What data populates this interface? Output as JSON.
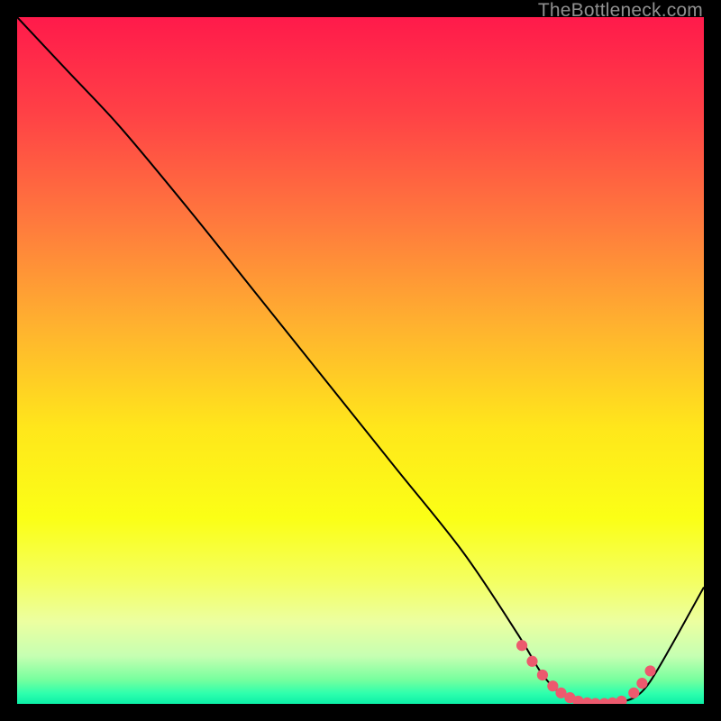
{
  "watermark": "TheBottleneck.com",
  "chart_data": {
    "type": "line",
    "title": "",
    "xlabel": "",
    "ylabel": "",
    "xlim": [
      0,
      100
    ],
    "ylim": [
      0,
      100
    ],
    "background": {
      "type": "vertical-gradient",
      "stops": [
        {
          "pos": 0.0,
          "color": "#ff1a4b"
        },
        {
          "pos": 0.14,
          "color": "#ff4146"
        },
        {
          "pos": 0.3,
          "color": "#ff7a3d"
        },
        {
          "pos": 0.45,
          "color": "#ffb22f"
        },
        {
          "pos": 0.6,
          "color": "#ffe71b"
        },
        {
          "pos": 0.73,
          "color": "#fbff16"
        },
        {
          "pos": 0.82,
          "color": "#f4ff60"
        },
        {
          "pos": 0.88,
          "color": "#ecffa0"
        },
        {
          "pos": 0.93,
          "color": "#c6ffb2"
        },
        {
          "pos": 0.965,
          "color": "#76ff9e"
        },
        {
          "pos": 0.985,
          "color": "#2dffad"
        },
        {
          "pos": 1.0,
          "color": "#0cf0a7"
        }
      ]
    },
    "series": [
      {
        "name": "bottleneck-curve",
        "color": "#000000",
        "x": [
          0.0,
          7.5,
          15.0,
          25.0,
          35.0,
          45.0,
          55.0,
          65.0,
          73.0,
          76.0,
          78.0,
          80.0,
          82.0,
          84.0,
          86.0,
          88.0,
          90.0,
          92.0,
          95.0,
          100.0
        ],
        "y": [
          100.0,
          92.0,
          84.0,
          72.0,
          59.5,
          47.0,
          34.5,
          22.0,
          10.0,
          5.0,
          2.5,
          1.0,
          0.3,
          0.0,
          0.0,
          0.3,
          1.0,
          3.0,
          8.0,
          17.0
        ]
      }
    ],
    "markers": {
      "name": "flat-region-markers",
      "color": "#ec5a6e",
      "radius_frac": 0.008,
      "points_x": [
        73.5,
        75.0,
        76.5,
        78.0,
        79.2,
        80.5,
        81.7,
        83.0,
        84.2,
        85.5,
        86.7,
        88.0,
        89.8,
        91.0,
        92.2
      ],
      "points_y": [
        8.5,
        6.2,
        4.2,
        2.6,
        1.6,
        0.9,
        0.4,
        0.15,
        0.05,
        0.05,
        0.15,
        0.4,
        1.6,
        3.0,
        4.8
      ]
    }
  }
}
